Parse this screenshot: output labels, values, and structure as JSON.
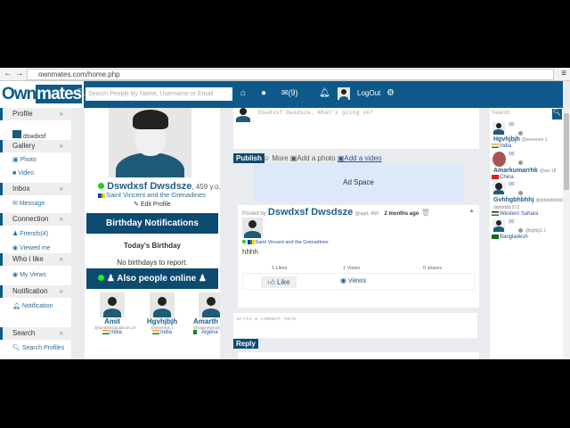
{
  "browser": {
    "url": "ownmates.com/home.php"
  },
  "header": {
    "logo_a": "Own",
    "logo_b": "mates",
    "search_placeholder": "Search People By Name, Username or Email",
    "messages": "(9)",
    "logout": "LogOut"
  },
  "sidebar": {
    "sections": [
      {
        "title": "Profile",
        "items": [
          "dswdxsf"
        ]
      },
      {
        "title": "Gallery",
        "items": [
          "Photo",
          "Video"
        ]
      },
      {
        "title": "Inbox",
        "items": [
          "Message"
        ]
      },
      {
        "title": "Connection",
        "items": [
          "Friends(4)",
          "Viewed me"
        ]
      },
      {
        "title": "Who i like",
        "items": [
          "My Views"
        ]
      },
      {
        "title": "Notification",
        "items": [
          "Notification"
        ]
      },
      {
        "title": "Search",
        "items": [
          "Search Profiles"
        ]
      }
    ]
  },
  "profile": {
    "name": "Dswdxsf Dwsdsze",
    "age": ", 459 y.o.",
    "country": "Saint Vincent and the Grenadines",
    "edit": "Edit Profile"
  },
  "birthday": {
    "title": "Birthday Notifications",
    "subtitle": "Today's Birthday",
    "empty": "No birthdays to report."
  },
  "online": {
    "title": "Also people online",
    "people": [
      {
        "name": "Amit",
        "handle": "@amitelesgmailcom,27",
        "country": "India"
      },
      {
        "name": "Hgvhjbjh",
        "handle": "@eeeeeee,1",
        "country": "India"
      },
      {
        "name": "Amarth",
        "handle": "@rajamegmailcom",
        "country": "Algeria"
      }
    ]
  },
  "composer": {
    "placeholder": "Dswdxsf Dwsdsze, What's going on?",
    "publish": "Publish",
    "more": "More",
    "add_photo": "Add a photo",
    "add_video": "Add a video"
  },
  "ad": {
    "label": "Ad Space"
  },
  "post": {
    "posted_by": "Posted by",
    "author": "Dswdxsf Dwsdsze",
    "meta": "@agit, 459",
    "time": "2 months ago",
    "country": "Saint Vincent and the Grenadines",
    "text": "hhhh",
    "likes": "1 Likes",
    "views": "1 Views",
    "shares": "0 shares",
    "like_btn": "Like",
    "views_btn": "views"
  },
  "comment": {
    "placeholder": "write a comment here",
    "reply": "Reply"
  },
  "right": {
    "search_placeholder": "Search",
    "users": [
      {
        "name": "Hgvhjbjh",
        "meta": "@eeeeeee 1",
        "country": "India"
      },
      {
        "name": "Amarkumarrhk",
        "meta": "@ani 18",
        "country": "China"
      },
      {
        "name": "Gvhhgbhbhhj",
        "meta": "@ddddddddd ddddddd 572",
        "country": "Western Sahara"
      },
      {
        "name": "",
        "meta": "@tgfdg1 1",
        "country": "Bangladesh"
      }
    ]
  }
}
